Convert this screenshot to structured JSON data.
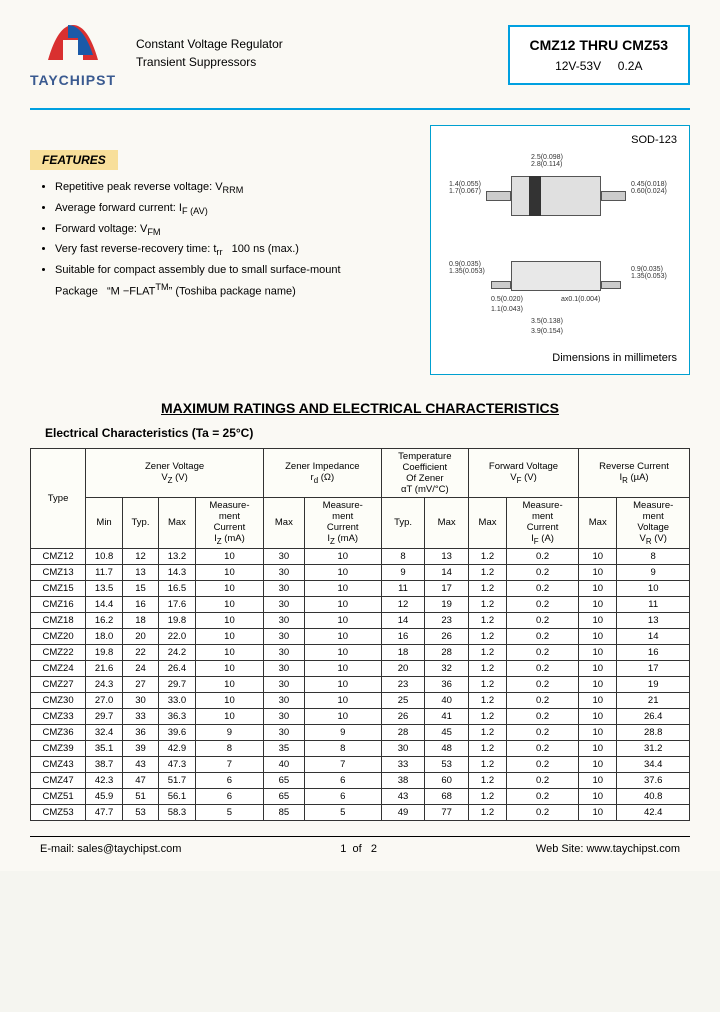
{
  "logo": {
    "name": "TAYCHIPST"
  },
  "desc": {
    "line1": "Constant Voltage Regulator",
    "line2": "Transient Suppressors"
  },
  "titleBox": {
    "range": "CMZ12 THRU CMZ53",
    "spec": "12V-53V     0.2A"
  },
  "features": {
    "heading": "FEATURES",
    "items": [
      "Repetitive peak reverse voltage: V<sub>RRM</sub>",
      "Average forward current: I<sub>F (AV)</sub>",
      "Forward voltage: V<sub>FM</sub>",
      "Very fast reverse-recovery time: t<sub>rr</sub>   100 ns (max.)",
      "Suitable for compact assembly due to small surface-mount"
    ],
    "packageLine": "Package   “M −FLAT<sup>TM</sup>” (Toshiba package name)"
  },
  "package": {
    "label": "SOD-123",
    "dimNote": "Dimensions in millimeters",
    "dims": {
      "bodyW": "2.5(0.098)\n2.8(0.114)",
      "bodyH": "1.4(0.055)\n1.7(0.067)",
      "bandW": "0.45(0.018)\n0.60(0.024)",
      "height": "0.9(0.035)\n1.35(0.053)",
      "lead": "0.5(0.020)",
      "leadT": "ax0.1(0.004)",
      "pitch": "3.5(0.138)",
      "total": "3.9(0.154)",
      "leadW": "1.1(0.043)"
    }
  },
  "sectionTitle": "MAXIMUM RATINGS AND ELECTRICAL CHARACTERISTICS",
  "subTitle": "Electrical Characteristics (Ta = 25°C)",
  "table": {
    "groupHeaders": {
      "zener": "Zener Voltage\nV<sub>Z</sub> (V)",
      "imped": "Zener Impedance\nr<sub>d</sub> (Ω)",
      "temp": "Temperature\nCoefficient\nOf Zener\nαT (mV/°C)",
      "fwd": "Forward Voltage\nV<sub>F</sub> (V)",
      "rev": "Reverse Current\nI<sub>R</sub> (µA)"
    },
    "subHeaders": {
      "type": "Type",
      "min": "Min",
      "typ": "Typ.",
      "max": "Max",
      "iz": "Measure-\nment\nCurrent\nI<sub>Z</sub> (mA)",
      "if": "Measure-\nment\nCurrent\nI<sub>F</sub> (A)",
      "vr": "Measure-\nment\nVoltage\nV<sub>R</sub> (V)"
    },
    "rows": [
      [
        "CMZ12",
        "10.8",
        "12",
        "13.2",
        "10",
        "30",
        "10",
        "8",
        "13",
        "1.2",
        "0.2",
        "10",
        "8"
      ],
      [
        "CMZ13",
        "11.7",
        "13",
        "14.3",
        "10",
        "30",
        "10",
        "9",
        "14",
        "1.2",
        "0.2",
        "10",
        "9"
      ],
      [
        "CMZ15",
        "13.5",
        "15",
        "16.5",
        "10",
        "30",
        "10",
        "11",
        "17",
        "1.2",
        "0.2",
        "10",
        "10"
      ],
      [
        "CMZ16",
        "14.4",
        "16",
        "17.6",
        "10",
        "30",
        "10",
        "12",
        "19",
        "1.2",
        "0.2",
        "10",
        "11"
      ],
      [
        "CMZ18",
        "16.2",
        "18",
        "19.8",
        "10",
        "30",
        "10",
        "14",
        "23",
        "1.2",
        "0.2",
        "10",
        "13"
      ],
      [
        "CMZ20",
        "18.0",
        "20",
        "22.0",
        "10",
        "30",
        "10",
        "16",
        "26",
        "1.2",
        "0.2",
        "10",
        "14"
      ],
      [
        "CMZ22",
        "19.8",
        "22",
        "24.2",
        "10",
        "30",
        "10",
        "18",
        "28",
        "1.2",
        "0.2",
        "10",
        "16"
      ],
      [
        "CMZ24",
        "21.6",
        "24",
        "26.4",
        "10",
        "30",
        "10",
        "20",
        "32",
        "1.2",
        "0.2",
        "10",
        "17"
      ],
      [
        "CMZ27",
        "24.3",
        "27",
        "29.7",
        "10",
        "30",
        "10",
        "23",
        "36",
        "1.2",
        "0.2",
        "10",
        "19"
      ],
      [
        "CMZ30",
        "27.0",
        "30",
        "33.0",
        "10",
        "30",
        "10",
        "25",
        "40",
        "1.2",
        "0.2",
        "10",
        "21"
      ],
      [
        "CMZ33",
        "29.7",
        "33",
        "36.3",
        "10",
        "30",
        "10",
        "26",
        "41",
        "1.2",
        "0.2",
        "10",
        "26.4"
      ],
      [
        "CMZ36",
        "32.4",
        "36",
        "39.6",
        "9",
        "30",
        "9",
        "28",
        "45",
        "1.2",
        "0.2",
        "10",
        "28.8"
      ],
      [
        "CMZ39",
        "35.1",
        "39",
        "42.9",
        "8",
        "35",
        "8",
        "30",
        "48",
        "1.2",
        "0.2",
        "10",
        "31.2"
      ],
      [
        "CMZ43",
        "38.7",
        "43",
        "47.3",
        "7",
        "40",
        "7",
        "33",
        "53",
        "1.2",
        "0.2",
        "10",
        "34.4"
      ],
      [
        "CMZ47",
        "42.3",
        "47",
        "51.7",
        "6",
        "65",
        "6",
        "38",
        "60",
        "1.2",
        "0.2",
        "10",
        "37.6"
      ],
      [
        "CMZ51",
        "45.9",
        "51",
        "56.1",
        "6",
        "65",
        "6",
        "43",
        "68",
        "1.2",
        "0.2",
        "10",
        "40.8"
      ],
      [
        "CMZ53",
        "47.7",
        "53",
        "58.3",
        "5",
        "85",
        "5",
        "49",
        "77",
        "1.2",
        "0.2",
        "10",
        "42.4"
      ]
    ]
  },
  "footer": {
    "email": "E-mail: sales@taychipst.com",
    "page": "1  of   2",
    "site": "Web Site: www.taychipst.com"
  }
}
